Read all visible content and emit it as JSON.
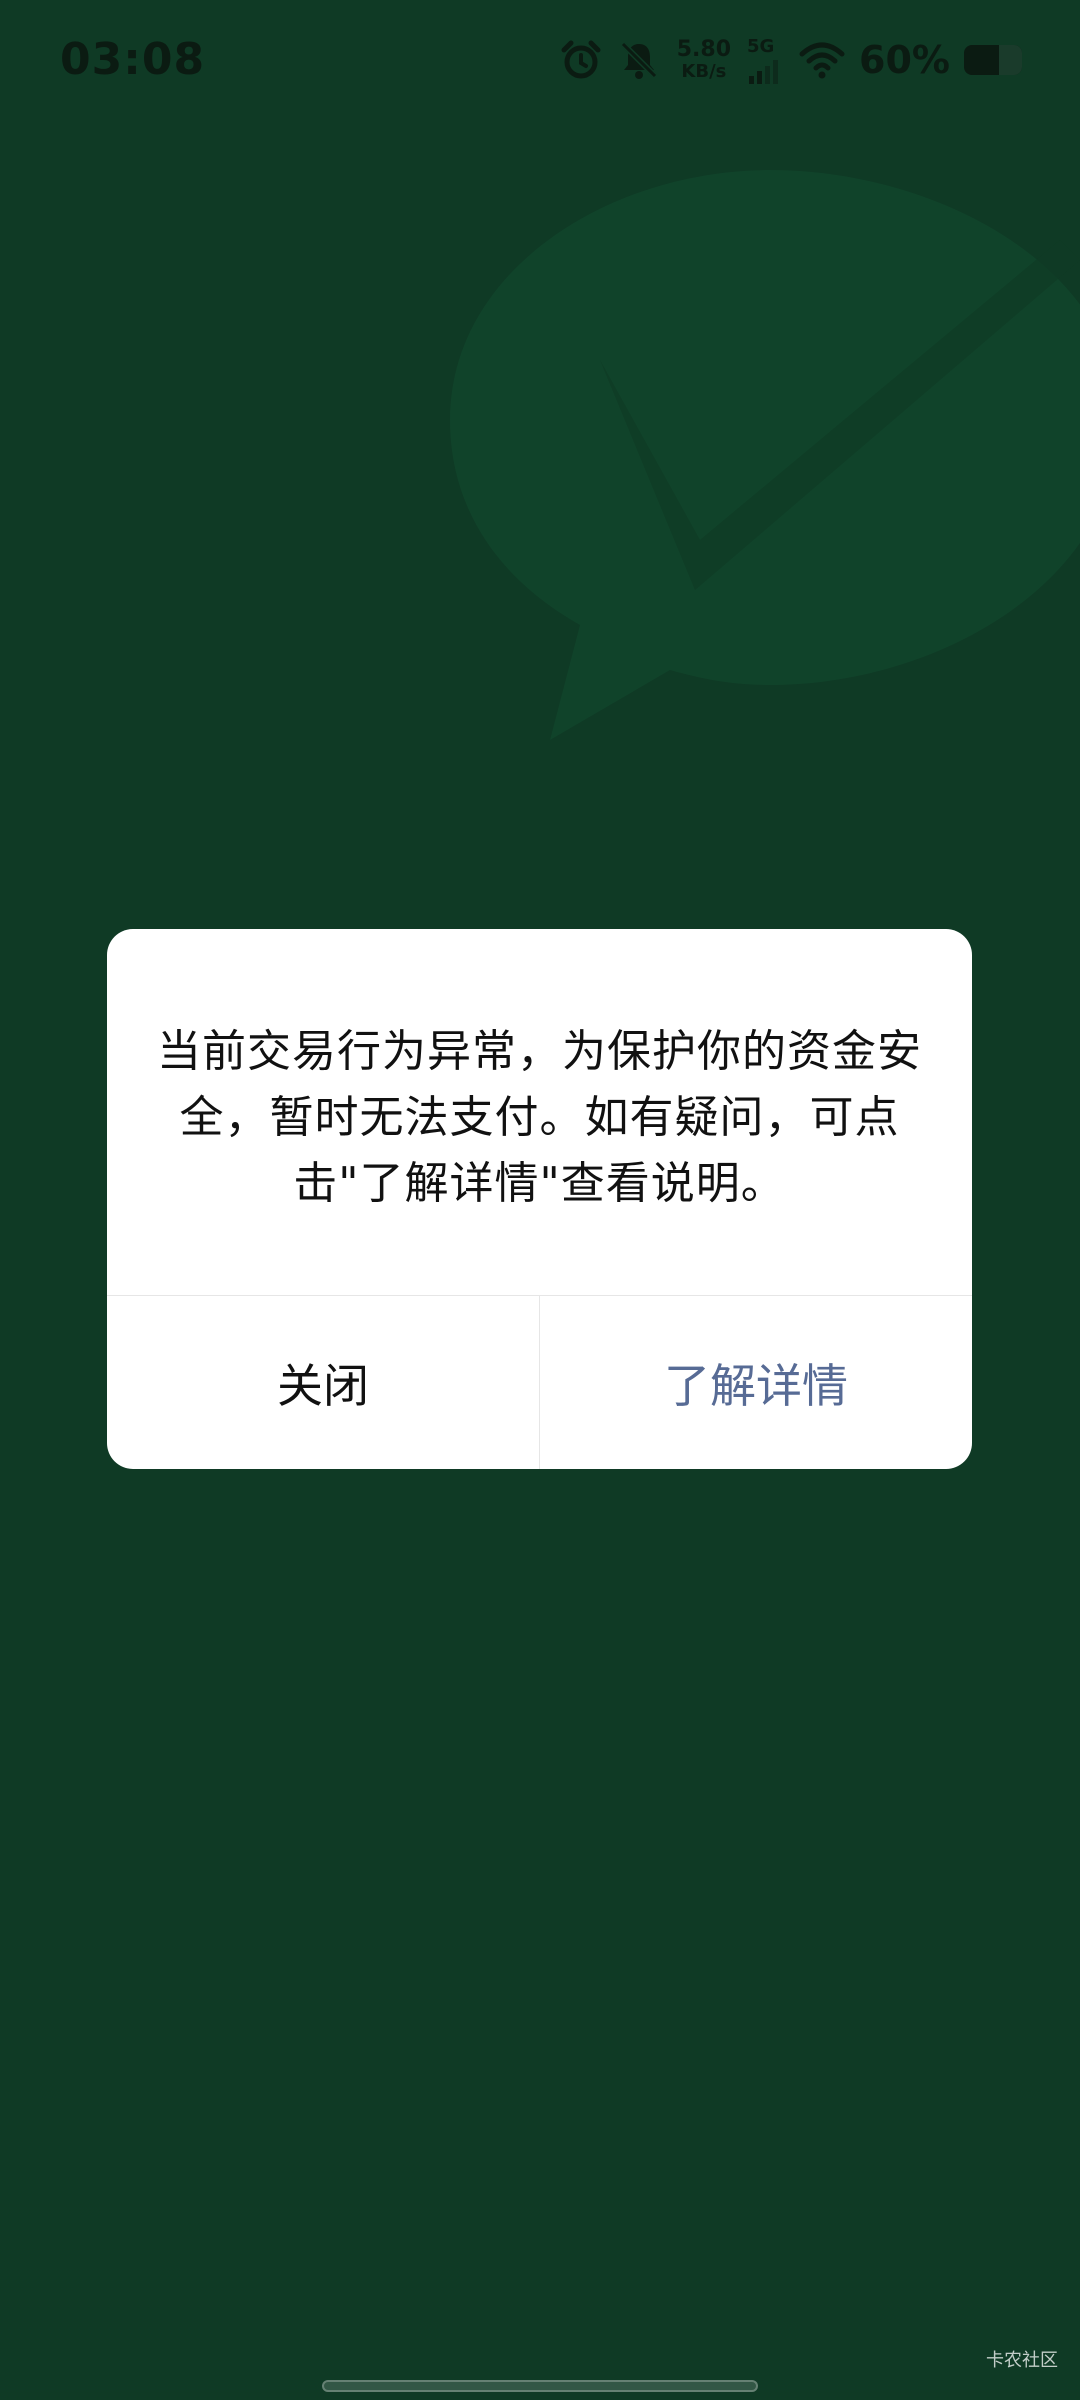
{
  "status_bar": {
    "time": "03:08",
    "net_speed_value": "5.80",
    "net_speed_unit": "KB/s",
    "network_type": "5G",
    "battery_percent": "60%",
    "battery_level": 0.6,
    "icons": [
      "alarm-icon",
      "mute-bell-icon",
      "signal-icon",
      "wifi-icon",
      "battery-icon"
    ]
  },
  "dialog": {
    "message": "当前交易行为异常，为保护你的资金安全，暂时无法支付。如有疑问，可点击\"了解详情\"查看说明。",
    "close_label": "关闭",
    "details_label": "了解详情"
  },
  "watermark": {
    "text": "卡农社区"
  },
  "colors": {
    "background": "#0f3a25",
    "dialog_bg": "#ffffff",
    "link": "#576b95",
    "text": "#111111"
  }
}
